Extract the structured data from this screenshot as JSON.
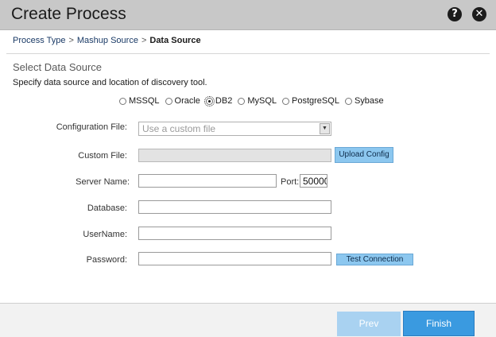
{
  "window": {
    "title": "Create Process",
    "help_icon": "help-icon",
    "close_icon": "close-icon"
  },
  "breadcrumb": {
    "items": [
      "Process Type",
      "Mashup Source",
      "Data Source"
    ],
    "separator": ">"
  },
  "section": {
    "title": "Select Data Source",
    "description": "Specify data source and location of discovery tool."
  },
  "data_sources": {
    "options": [
      "MSSQL",
      "Oracle",
      "DB2",
      "MySQL",
      "PostgreSQL",
      "Sybase"
    ],
    "selected": "DB2"
  },
  "form": {
    "config_file_label": "Configuration File:",
    "config_file_value": "Use a custom file",
    "custom_file_label": "Custom File:",
    "upload_config_label": "Upload Config",
    "server_name_label": "Server Name:",
    "server_name_value": "",
    "port_label": "Port:",
    "port_value": "50000",
    "database_label": "Database:",
    "database_value": "",
    "username_label": "UserName:",
    "username_value": "",
    "password_label": "Password:",
    "password_value": "",
    "test_connection_label": "Test Connection"
  },
  "footer": {
    "prev_label": "Prev",
    "finish_label": "Finish"
  },
  "colors": {
    "title_bar": "#c8c8c8",
    "primary_button": "#3a9ae0",
    "disabled_button": "#a9d2f1",
    "secondary_button": "#8cc7ef"
  }
}
